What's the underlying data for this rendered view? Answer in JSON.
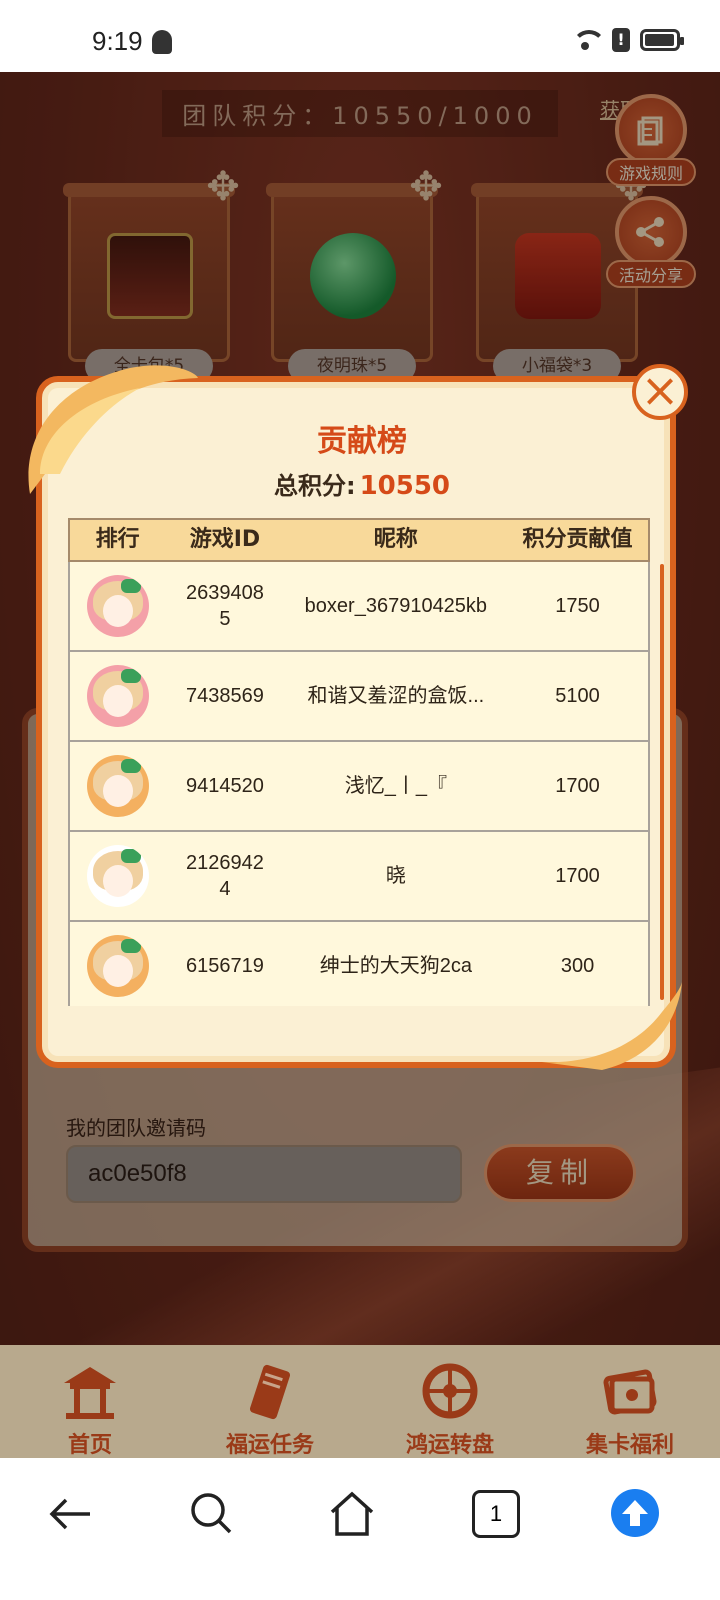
{
  "status_bar": {
    "time": "9:19"
  },
  "game": {
    "team_score": "团队积分：10550/1000",
    "acquire_link": "获取",
    "rewards": [
      {
        "label": "全卡包*5",
        "icon": "card-pack-icon",
        "color": "#6a2a1a"
      },
      {
        "label": "夜明珠*5",
        "icon": "pearl-icon",
        "color": "#2fa050"
      },
      {
        "label": "小福袋*3",
        "icon": "lucky-bag-icon",
        "color": "#c2301e"
      }
    ],
    "side_buttons": [
      {
        "label": "游戏规则",
        "icon": "rules-icon"
      },
      {
        "label": "活动分享",
        "icon": "share-icon"
      }
    ],
    "invite": {
      "label": "我的团队邀请码",
      "code": "ac0e50f8",
      "copy_label": "复制"
    }
  },
  "modal": {
    "title": "贡献榜",
    "total_label": "总积分:",
    "total_value": "10550",
    "columns": [
      "排行",
      "游戏ID",
      "昵称",
      "积分贡献值"
    ],
    "rows": [
      {
        "avatar": "avatar-pink-bow",
        "game_id": "26394085",
        "nickname": "boxer_367910425kb",
        "points": "1750"
      },
      {
        "avatar": "avatar-pink-bow",
        "game_id": "7438569",
        "nickname": "和谐又羞涩的盒饭...",
        "points": "5100"
      },
      {
        "avatar": "avatar-orange-wink",
        "game_id": "9414520",
        "nickname": "浅忆_丨_『",
        "points": "1700"
      },
      {
        "avatar": "avatar-green-wink",
        "game_id": "21269424",
        "nickname": "晓",
        "points": "1700"
      },
      {
        "avatar": "avatar-orange-wink",
        "game_id": "6156719",
        "nickname": "绅士的大天狗2ca",
        "points": "300"
      }
    ]
  },
  "nav": {
    "items": [
      {
        "label": "首页",
        "icon": "pavilion-icon"
      },
      {
        "label": "福运任务",
        "icon": "scroll-icon"
      },
      {
        "label": "鸿运转盘",
        "icon": "wheel-icon"
      },
      {
        "label": "集卡福利",
        "icon": "cards-icon"
      }
    ]
  },
  "browser": {
    "tab_count": "1"
  },
  "colors": {
    "accent": "#d54a18",
    "nav_label": "#9a3a18",
    "browser_up": "#1a7ef0"
  }
}
